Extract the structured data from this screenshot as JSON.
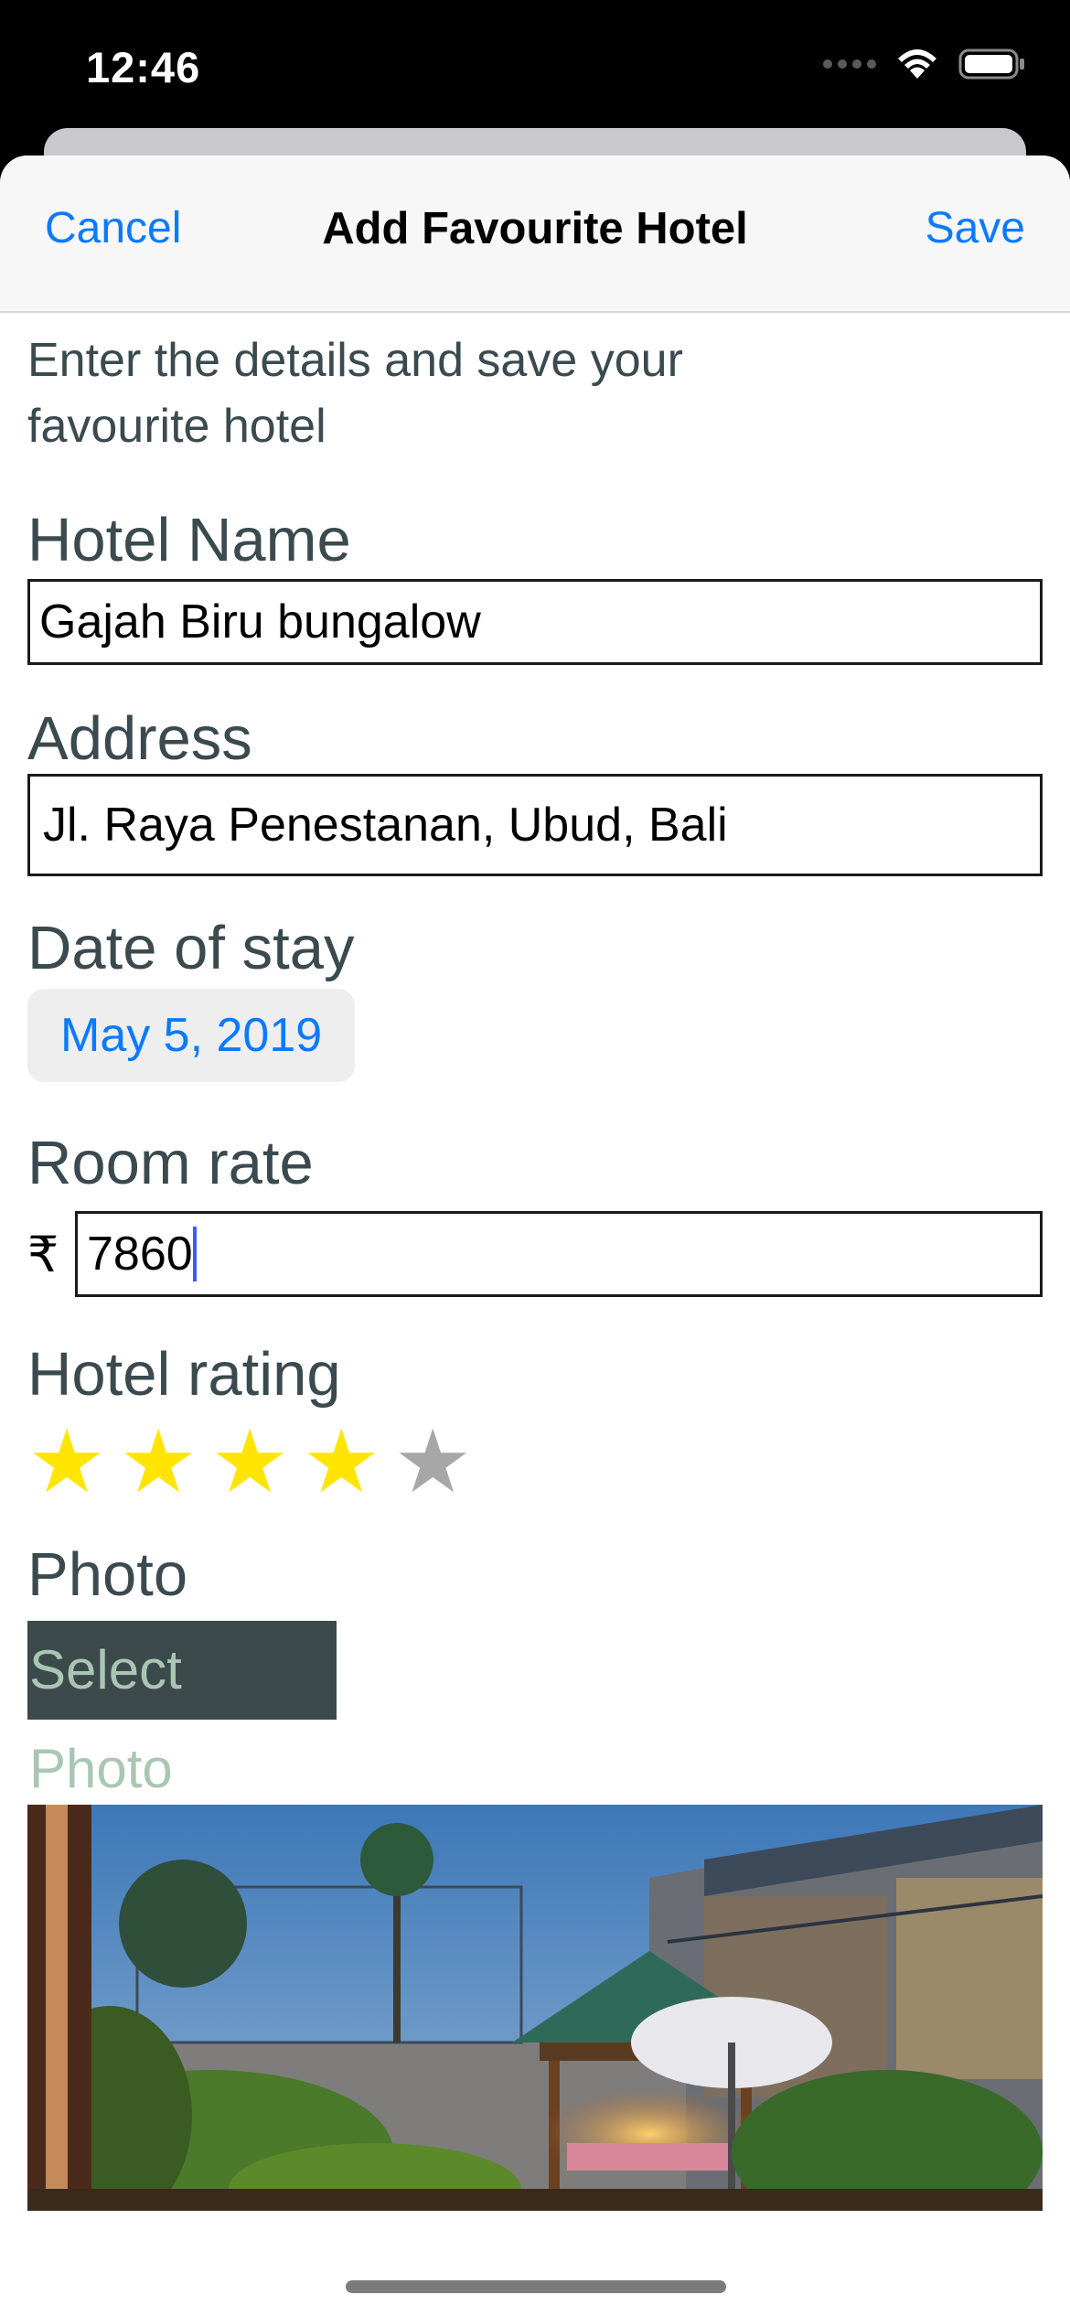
{
  "status": {
    "time": "12:46"
  },
  "nav": {
    "cancel_label": "Cancel",
    "title": "Add Favourite Hotel",
    "save_label": "Save"
  },
  "form": {
    "intro": "Enter the details and save your favourite hotel",
    "hotel_name_label": "Hotel Name",
    "hotel_name_value": "Gajah Biru bungalow",
    "address_label": "Address",
    "address_value": "Jl. Raya Penestanan, Ubud, Bali",
    "date_label": "Date of stay",
    "date_value": "May 5, 2019",
    "room_rate_label": "Room rate",
    "currency_symbol": "₹",
    "room_rate_value": "7860",
    "rating_label": "Hotel rating",
    "rating_value": 4,
    "rating_max": 5,
    "photo_label": "Photo",
    "select_photo_label": "Select Photo"
  },
  "colors": {
    "accent": "#0a7aff",
    "label_text": "#3a4a4f",
    "star_filled": "#ffe500",
    "star_empty": "#a7a7a7",
    "select_photo_bg": "#3c4a4b",
    "select_photo_text": "#a9c6b3"
  }
}
